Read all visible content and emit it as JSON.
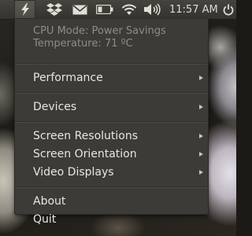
{
  "panel": {
    "icons": [
      "lightning-icon",
      "dropbox-icon",
      "mail-icon",
      "battery-icon",
      "wifi-icon",
      "volume-icon"
    ],
    "clock": "11:57 AM",
    "power_icon": "power-icon"
  },
  "menu": {
    "info_lines": [
      "CPU Mode: Power Savings",
      "Temperature: 71 ºC"
    ],
    "groups": [
      [
        {
          "label": "Performance",
          "submenu": true
        }
      ],
      [
        {
          "label": "Devices",
          "submenu": true
        }
      ],
      [
        {
          "label": "Screen Resolutions",
          "submenu": true
        },
        {
          "label": "Screen Orientation",
          "submenu": true
        },
        {
          "label": "Video Displays",
          "submenu": true
        }
      ],
      [
        {
          "label": "About",
          "submenu": false
        },
        {
          "label": "Quit",
          "submenu": false
        }
      ]
    ]
  },
  "colors": {
    "panel": "#3a3935",
    "menu_bg": "#3c3b37",
    "menu_text": "#e9e6df",
    "info_text": "#8f8c85"
  }
}
